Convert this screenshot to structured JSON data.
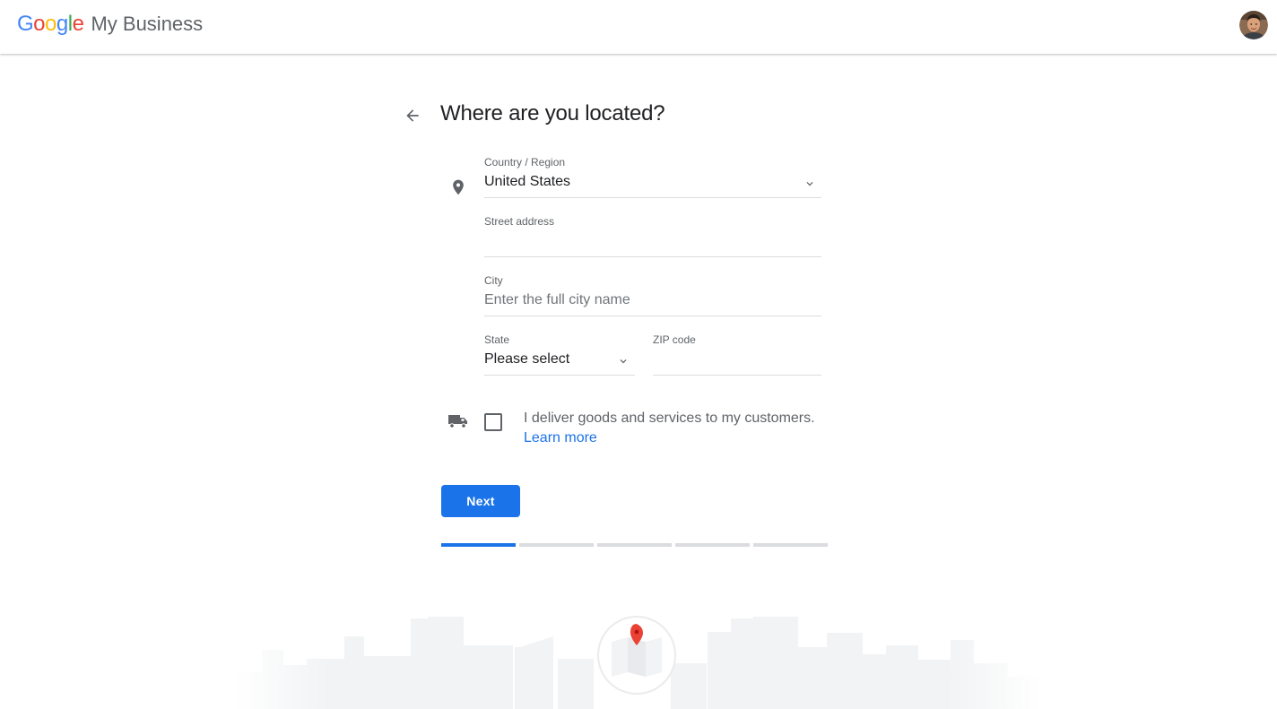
{
  "header": {
    "logo": {
      "letters": [
        {
          "char": "G",
          "color": "#4285F4"
        },
        {
          "char": "o",
          "color": "#EA4335"
        },
        {
          "char": "o",
          "color": "#FBBC05"
        },
        {
          "char": "g",
          "color": "#4285F4"
        },
        {
          "char": "l",
          "color": "#34A853"
        },
        {
          "char": "e",
          "color": "#EA4335"
        }
      ]
    },
    "product_name": "My Business",
    "avatar_icon": "user-avatar"
  },
  "page": {
    "back_icon": "arrow-left-icon",
    "title": "Where are you located?"
  },
  "form": {
    "location_icon": "map-pin-icon",
    "country": {
      "label": "Country / Region",
      "value": "United States"
    },
    "street": {
      "label": "Street address",
      "value": ""
    },
    "city": {
      "label": "City",
      "placeholder": "Enter the full city name"
    },
    "state": {
      "label": "State",
      "value": "Please select"
    },
    "zip": {
      "label": "ZIP code",
      "value": ""
    }
  },
  "delivery": {
    "icon": "truck-icon",
    "checked": false,
    "text": "I deliver goods and services to my customers.",
    "learn_more": "Learn more"
  },
  "actions": {
    "next_label": "Next"
  },
  "progress": {
    "total_steps": 5,
    "current_step": 1
  },
  "colors": {
    "accent": "#1a73e8",
    "pin_red": "#ea4335",
    "divider": "#dadce0"
  }
}
